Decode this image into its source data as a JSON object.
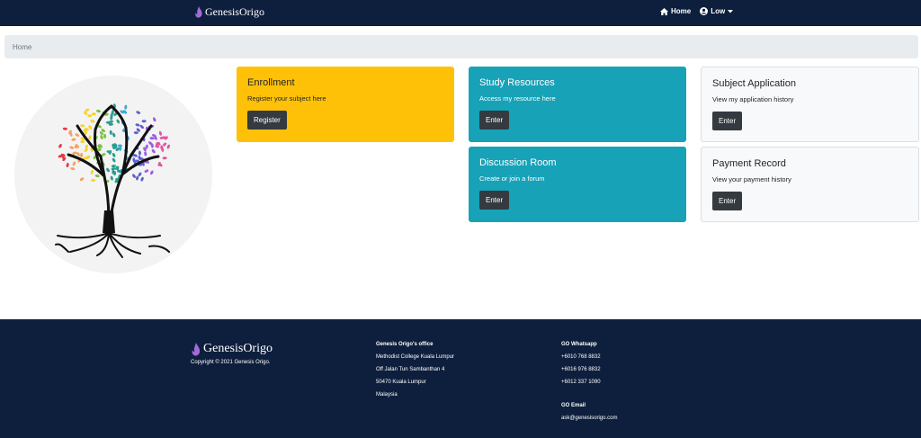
{
  "brand": {
    "name": "GenesisOrigo"
  },
  "nav": {
    "home_label": "Home",
    "user_label": "Low"
  },
  "breadcrumb": {
    "home": "Home"
  },
  "cards": {
    "enrollment": {
      "title": "Enrollment",
      "text": "Register your subject here",
      "button": "Register"
    },
    "study": {
      "title": "Study Resources",
      "text": "Access my resource here",
      "button": "Enter"
    },
    "application": {
      "title": "Subject Application",
      "text": "View my application history",
      "button": "Enter"
    },
    "discussion": {
      "title": "Discussion Room",
      "text": "Create or join a forum",
      "button": "Enter"
    },
    "payment": {
      "title": "Payment Record",
      "text": "View your payment history",
      "button": "Enter"
    }
  },
  "footer": {
    "brand": "GenesisOrigo",
    "copyright": "Copyright © 2021 Genesis Origo.",
    "office": {
      "heading": "Genesis Origo's office",
      "lines": [
        "Methodist College Kuala Lumpur",
        "Off Jalan Tun Sambanthan 4",
        "50470 Kuala Lumpur",
        "Malaysia"
      ]
    },
    "whatsapp": {
      "heading": "GO Whatsapp",
      "numbers": [
        "+6010 768 8832",
        "+6016 976 8832",
        "+6012 337 1090"
      ]
    },
    "email": {
      "heading": "GO Email",
      "address": "ask@genesisorigo.com"
    }
  },
  "colors": {
    "navy": "#0e1f3d",
    "yellow": "#ffc107",
    "teal": "#17a2b8",
    "dark_button": "#343a40"
  }
}
